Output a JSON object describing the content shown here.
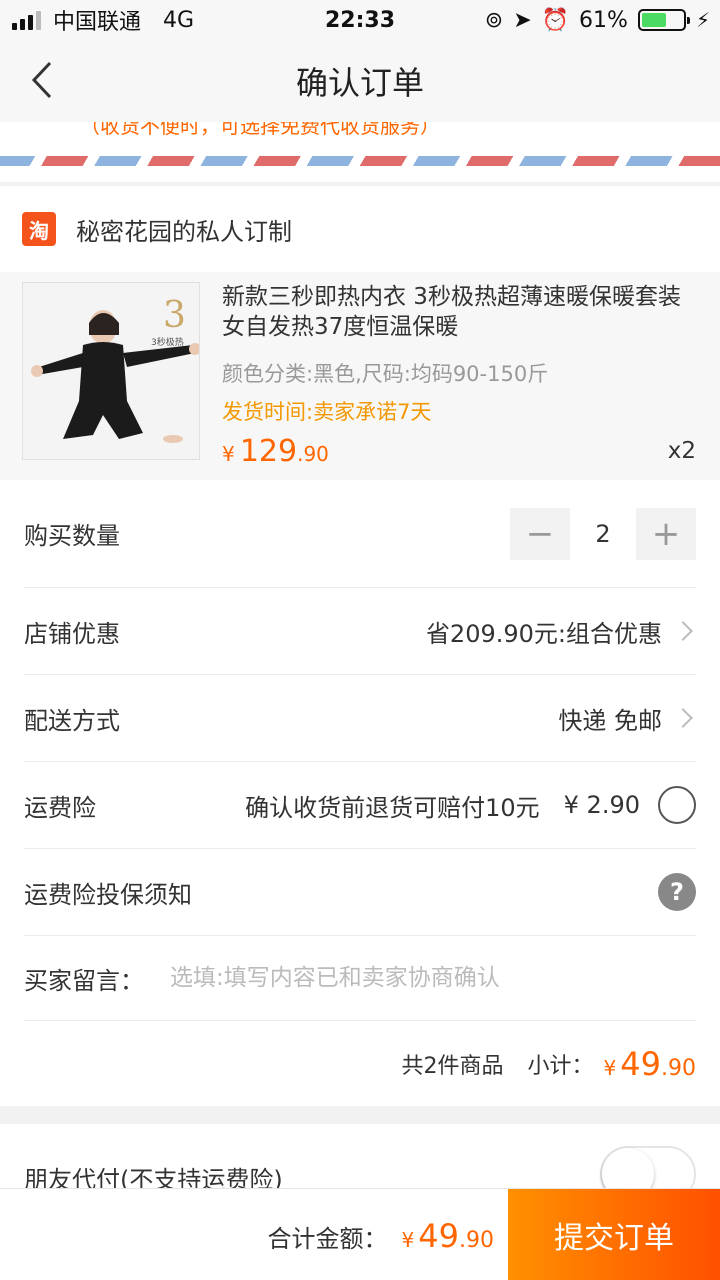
{
  "status_bar": {
    "carrier": "中国联通",
    "network": "4G",
    "time": "22:33",
    "battery_level": "61%",
    "battery_fraction": 0.61
  },
  "nav": {
    "back_icon": "chevron-left-icon",
    "title": "确认订单"
  },
  "address_tip": "（收货不便时，可选择免费代收货服务）",
  "shop": {
    "logo_text": "淘",
    "name": "秘密花园的私人订制"
  },
  "product": {
    "title": "新款三秒即热内衣 3秒极热超薄速暖保暖套装女自发热37度恒温保暖",
    "sku": "颜色分类:黑色,尺码:均码90-150斤",
    "ship_time": "发货时间:卖家承诺7天",
    "price_symbol": "¥",
    "price_int": "129",
    "price_dec": ".90",
    "quantity_label": "x2",
    "thumb_badge": "3秒极热"
  },
  "quantity": {
    "label": "购买数量",
    "minus": "−",
    "value": "2",
    "plus": "+"
  },
  "shop_discount": {
    "label": "店铺优惠",
    "value": "省209.90元:组合优惠"
  },
  "delivery": {
    "label": "配送方式",
    "value": "快递 免邮"
  },
  "shipping_insurance": {
    "label": "运费险",
    "desc": "确认收货前退货可赔付10元",
    "price": "¥ 2.90",
    "checked": false
  },
  "insurance_notice": {
    "label": "运费险投保须知",
    "icon": "?"
  },
  "buyer_message": {
    "label": "买家留言：",
    "placeholder": "选填:填写内容已和卖家协商确认"
  },
  "subtotal": {
    "count": "共2件商品",
    "label": "小计：",
    "symbol": "¥",
    "int": "49",
    "dec": ".90"
  },
  "friend_pay": {
    "label": "朋友代付(不支持运费险)",
    "enabled": false
  },
  "bottom_bar": {
    "total_label": "合计金额：",
    "symbol": "¥",
    "int": "49",
    "dec": ".90",
    "submit": "提交订单"
  },
  "colors": {
    "accent": "#ff6600",
    "submit_start": "#ff9000",
    "submit_end": "#ff5000",
    "ship_time": "#f39800",
    "taobao_logo": "#f5531c"
  }
}
